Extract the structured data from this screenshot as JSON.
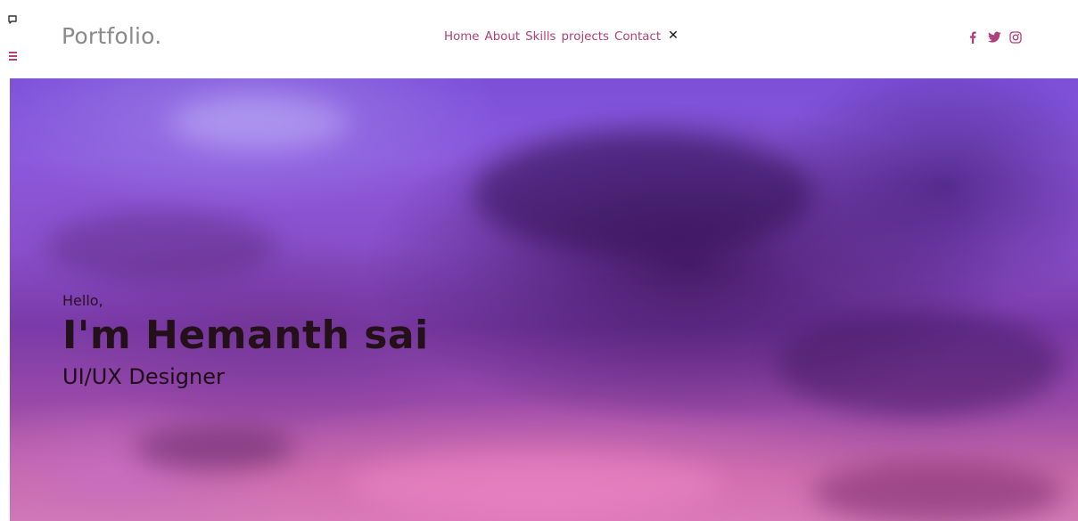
{
  "header": {
    "logo": "Portfolio.",
    "nav": {
      "items": [
        {
          "label": "Home"
        },
        {
          "label": "About"
        },
        {
          "label": "Skills"
        },
        {
          "label": "projects"
        },
        {
          "label": "Contact"
        }
      ],
      "close_glyph": "✕"
    },
    "social": [
      "facebook-icon",
      "twitter-icon",
      "instagram-icon"
    ]
  },
  "hero": {
    "greeting": "Hello,",
    "name": "I'm Hemanth sai",
    "role": "UI/UX Designer"
  },
  "colors": {
    "accent": "#b0407a",
    "logo": "#8a8a8a"
  }
}
